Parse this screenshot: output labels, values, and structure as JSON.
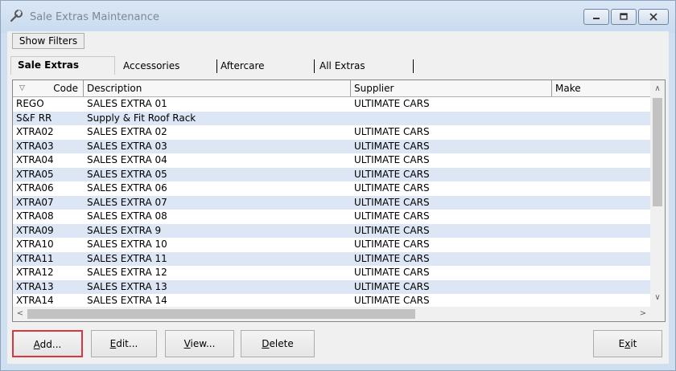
{
  "window": {
    "title": "Sale Extras Maintenance"
  },
  "toolbar": {
    "show_filters": "Show Filters"
  },
  "tabs": [
    "Sale Extras",
    "Accessories",
    "Aftercare",
    "All Extras"
  ],
  "grid": {
    "columns": [
      "Code",
      "Description",
      "Supplier",
      "Make"
    ],
    "rows": [
      [
        "REGO",
        "SALES EXTRA 01",
        "ULTIMATE CARS",
        ""
      ],
      [
        "S&F RR",
        "Supply & Fit Roof Rack",
        "",
        ""
      ],
      [
        "XTRA02",
        "SALES EXTRA 02",
        "ULTIMATE CARS",
        ""
      ],
      [
        "XTRA03",
        "SALES EXTRA 03",
        "ULTIMATE CARS",
        ""
      ],
      [
        "XTRA04",
        "SALES EXTRA 04",
        "ULTIMATE CARS",
        ""
      ],
      [
        "XTRA05",
        "SALES EXTRA 05",
        "ULTIMATE CARS",
        ""
      ],
      [
        "XTRA06",
        "SALES EXTRA 06",
        "ULTIMATE CARS",
        ""
      ],
      [
        "XTRA07",
        "SALES EXTRA 07",
        "ULTIMATE CARS",
        ""
      ],
      [
        "XTRA08",
        "SALES EXTRA 08",
        "ULTIMATE CARS",
        ""
      ],
      [
        "XTRA09",
        "SALES EXTRA 9",
        "ULTIMATE CARS",
        ""
      ],
      [
        "XTRA10",
        "SALES EXTRA 10",
        "ULTIMATE CARS",
        ""
      ],
      [
        "XTRA11",
        "SALES EXTRA 11",
        "ULTIMATE CARS",
        ""
      ],
      [
        "XTRA12",
        "SALES EXTRA 12",
        "ULTIMATE CARS",
        ""
      ],
      [
        "XTRA13",
        "SALES EXTRA 13",
        "ULTIMATE CARS",
        ""
      ],
      [
        "XTRA14",
        "SALES EXTRA 14",
        "ULTIMATE CARS",
        ""
      ]
    ]
  },
  "buttons": {
    "add": {
      "key": "A",
      "rest": "dd..."
    },
    "edit": {
      "key": "E",
      "rest": "dit..."
    },
    "view": {
      "key": "V",
      "rest": "iew..."
    },
    "delete": {
      "key": "D",
      "rest": "elete"
    },
    "exit": {
      "pre": "E",
      "key": "x",
      "rest": "it"
    }
  },
  "icons": {
    "title": "wrench-icon",
    "minimize": "minimize-icon",
    "maximize": "maximize-icon",
    "close": "close-icon",
    "sort": "sort-indicator-icon",
    "scroll_up": "scroll-up-icon",
    "scroll_down": "scroll-down-icon",
    "scroll_left": "scroll-left-icon",
    "scroll_right": "scroll-right-icon"
  },
  "colors": {
    "row_alt": "#dce6f4",
    "focus_border": "#d9363e",
    "title_text": "#7d8896"
  }
}
